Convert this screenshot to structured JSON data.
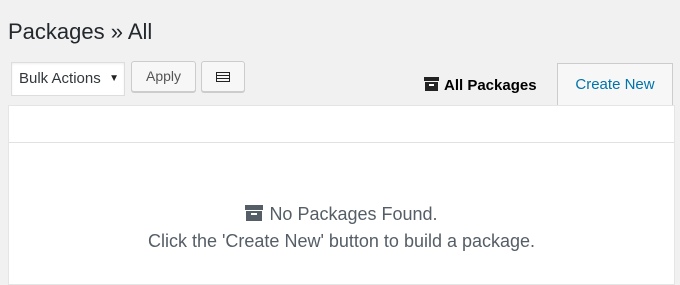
{
  "header": {
    "title": "Packages » All"
  },
  "toolbar": {
    "bulk_actions_value": "Bulk Actions",
    "apply_label": "Apply",
    "grid_icon": "grid-icon",
    "all_packages_label": "All Packages",
    "all_packages_icon": "archive-icon",
    "create_new_label": "Create New"
  },
  "empty_state": {
    "icon": "archive-icon",
    "title": "No Packages Found.",
    "message": "Click the 'Create New' button to build a package."
  },
  "colors": {
    "background": "#f1f1f1",
    "panel": "#ffffff",
    "link": "#0073aa",
    "text": "#23282d",
    "muted_text": "#555d66"
  }
}
